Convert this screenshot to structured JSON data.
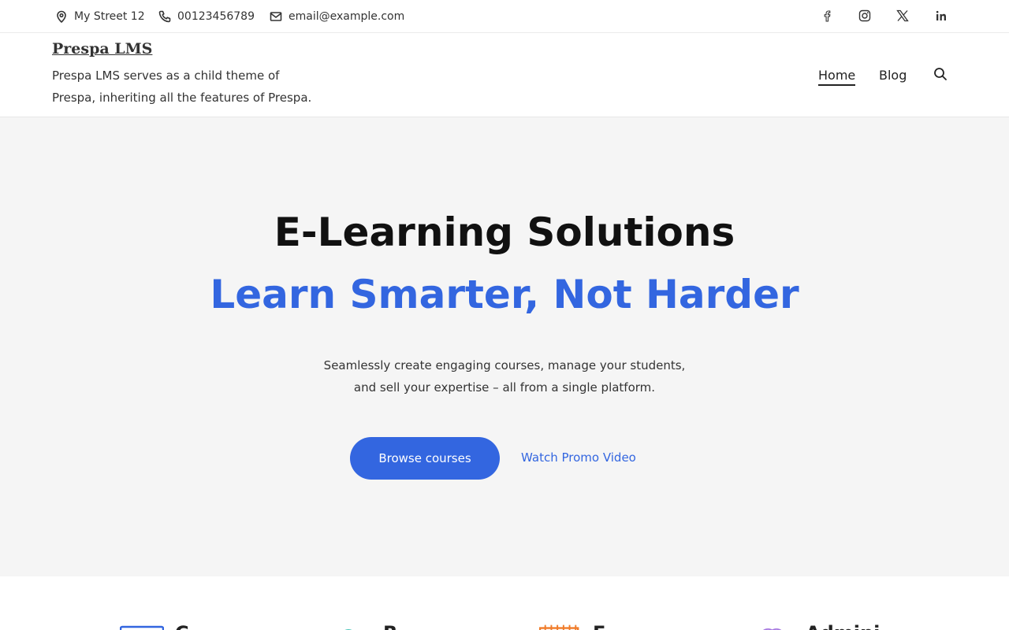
{
  "topbar": {
    "address": "My Street 12",
    "phone": "00123456789",
    "email": "email@example.com"
  },
  "header": {
    "site_title": "Prespa LMS",
    "tagline": "Prespa LMS serves as a child theme of Prespa, inheriting all the features of Prespa.",
    "nav": [
      {
        "label": "Home",
        "active": true
      },
      {
        "label": "Blog",
        "active": false
      }
    ]
  },
  "hero": {
    "title": "E-Learning Solutions",
    "subtitle": "Learn Smarter, Not Harder",
    "description_line1": "Seamlessly create engaging courses, manage your students,",
    "description_line2": "and sell your expertise – all from a single platform.",
    "primary_button": "Browse courses",
    "secondary_link": "Watch Promo Video"
  },
  "features": [
    {
      "label": "C",
      "icon": "laptop-icon",
      "color": "#3366e0"
    },
    {
      "label": "R",
      "icon": "clock-icon",
      "color": "#2bbbad"
    },
    {
      "label": "E",
      "icon": "calendar-icon",
      "color": "#f07c2a"
    },
    {
      "label": "Admini",
      "icon": "users-icon",
      "color": "#a678e0"
    }
  ],
  "colors": {
    "accent": "#3366e0",
    "hero_background": "#f5f5f5"
  }
}
